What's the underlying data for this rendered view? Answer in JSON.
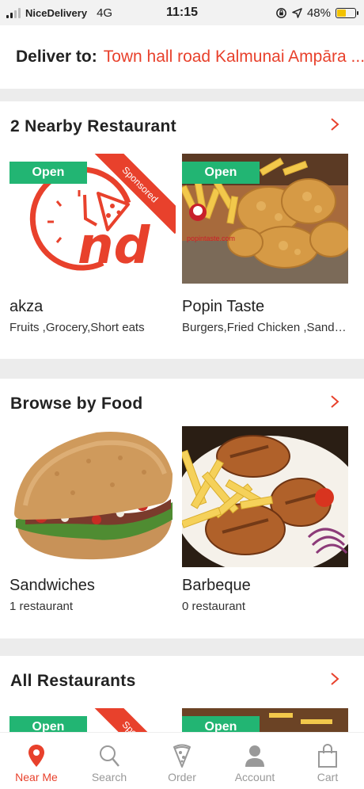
{
  "status_bar": {
    "carrier": "NiceDelivery",
    "network": "4G",
    "time": "11:15",
    "battery": "48%",
    "battery_level": 0.48
  },
  "deliver": {
    "label": "Deliver to:",
    "address": "Town hall road Kalmunai Ampāra ..."
  },
  "colors": {
    "accent": "#e8412c",
    "open_badge": "#22b573"
  },
  "nearby": {
    "title": "2 Nearby Restaurant",
    "restaurants": [
      {
        "name": "akza",
        "categories": "Fruits ,Grocery,Short eats",
        "badge": "Open",
        "sponsored": "Sponsored",
        "logo_text": "nd"
      },
      {
        "name": "Popin Taste",
        "categories": "Burgers,Fried Chicken ,Sandwiches",
        "badge": "Open",
        "watermark": "popintaste.com"
      }
    ]
  },
  "browse": {
    "title": "Browse by Food",
    "foods": [
      {
        "name": "Sandwiches",
        "count": "1 restaurant"
      },
      {
        "name": "Barbeque",
        "count": "0 restaurant"
      }
    ]
  },
  "all": {
    "title": "All Restaurants",
    "badges": [
      "Open",
      "Open"
    ],
    "sponsored": "Sponsored"
  },
  "nav": {
    "items": [
      {
        "label": "Near Me",
        "icon": "location-pin-icon",
        "active": true
      },
      {
        "label": "Search",
        "icon": "search-icon"
      },
      {
        "label": "Order",
        "icon": "pizza-slice-icon"
      },
      {
        "label": "Account",
        "icon": "user-icon"
      },
      {
        "label": "Cart",
        "icon": "shopping-bag-icon"
      }
    ]
  }
}
